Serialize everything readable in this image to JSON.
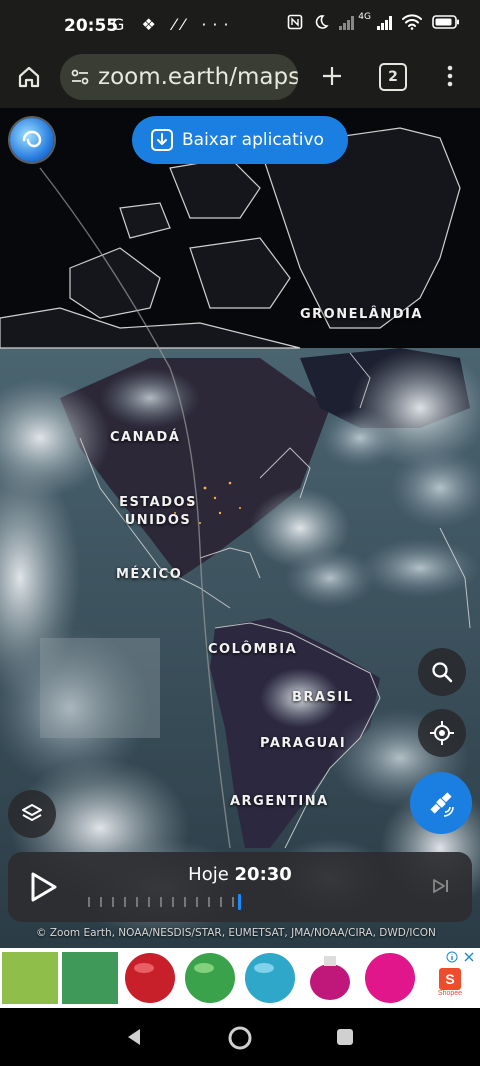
{
  "status_bar": {
    "time": "20:55",
    "left_icons": "G ❖ ⁄⁄ ···",
    "network": "4G",
    "icons": [
      "nfc-icon",
      "moon-icon",
      "signal-icon",
      "wifi-icon",
      "battery-icon"
    ]
  },
  "browser": {
    "url": "zoom.earth/maps",
    "tab_count": "2"
  },
  "map": {
    "download_button": "Baixar aplicativo",
    "labels": {
      "greenland": "GRONELÂNDIA",
      "canada": "CANADÁ",
      "usa": "ESTADOS UNIDOS",
      "mexico": "MÉXICO",
      "colombia": "COLÔMBIA",
      "brazil": "BRASIL",
      "paraguay": "PARAGUAI",
      "argentina": "ARGENTINA"
    },
    "controls": [
      "search-icon",
      "locate-icon",
      "satellite-icon",
      "layers-icon"
    ]
  },
  "player": {
    "day": "Hoje",
    "time": "20:30"
  },
  "attribution": "© Zoom Earth, NOAA/NESDIS/STAR, EUMETSAT, JMA/NOAA/CIRA, DWD/ICON",
  "ad": {
    "brand": "Shopee",
    "colors": [
      "#8fbf4a",
      "#3f9a5a",
      "#c8202a",
      "#3aa24a",
      "#2fa7c8",
      "#c0187a",
      "#e0168a"
    ]
  },
  "colors": {
    "accent": "#1a7fe0",
    "chrome": "#1c1d1a",
    "omnibox": "#3a3d33"
  }
}
